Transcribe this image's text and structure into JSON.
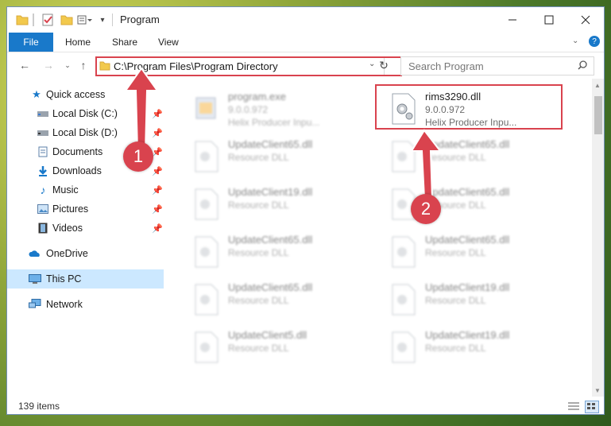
{
  "window": {
    "title": "Program"
  },
  "ribbon": {
    "file": "File",
    "home": "Home",
    "share": "Share",
    "view": "View"
  },
  "nav": {
    "address": "C:\\Program Files\\Program Directory",
    "search_placeholder": "Search Program"
  },
  "sidebar": {
    "quick_access": "Quick access",
    "items": [
      {
        "label": "Local Disk (C:)"
      },
      {
        "label": "Local Disk (D:)"
      },
      {
        "label": "Documents"
      },
      {
        "label": "Downloads"
      },
      {
        "label": "Music"
      },
      {
        "label": "Pictures"
      },
      {
        "label": "Videos"
      }
    ],
    "onedrive": "OneDrive",
    "this_pc": "This PC",
    "network": "Network"
  },
  "files": [
    {
      "name": "program.exe",
      "line2": "9.0.0.972",
      "line3": "Helix Producer Inpu..."
    },
    {
      "name": "rims3290.dll",
      "line2": "9.0.0.972",
      "line3": "Helix Producer Inpu..."
    },
    {
      "name": "UpdateClient65.dll",
      "line2": "Resource DLL"
    },
    {
      "name": "UpdateClient65.dll",
      "line2": "Resource DLL"
    },
    {
      "name": "UpdateClient19.dll",
      "line2": "Resource DLL"
    },
    {
      "name": "UpdateClient65.dll",
      "line2": "Resource DLL"
    },
    {
      "name": "UpdateClient65.dll",
      "line2": "Resource DLL"
    },
    {
      "name": "UpdateClient65.dll",
      "line2": "Resource DLL"
    },
    {
      "name": "UpdateClient65.dll",
      "line2": "Resource DLL"
    },
    {
      "name": "UpdateClient19.dll",
      "line2": "Resource DLL"
    },
    {
      "name": "UpdateClient5.dll",
      "line2": "Resource DLL"
    },
    {
      "name": "UpdateClient19.dll",
      "line2": "Resource DLL"
    }
  ],
  "status": {
    "items": "139 items"
  },
  "annotations": {
    "step1": "1",
    "step2": "2"
  },
  "colors": {
    "accent": "#1979ca",
    "highlight": "#d9434e",
    "selected": "#cce8ff"
  }
}
